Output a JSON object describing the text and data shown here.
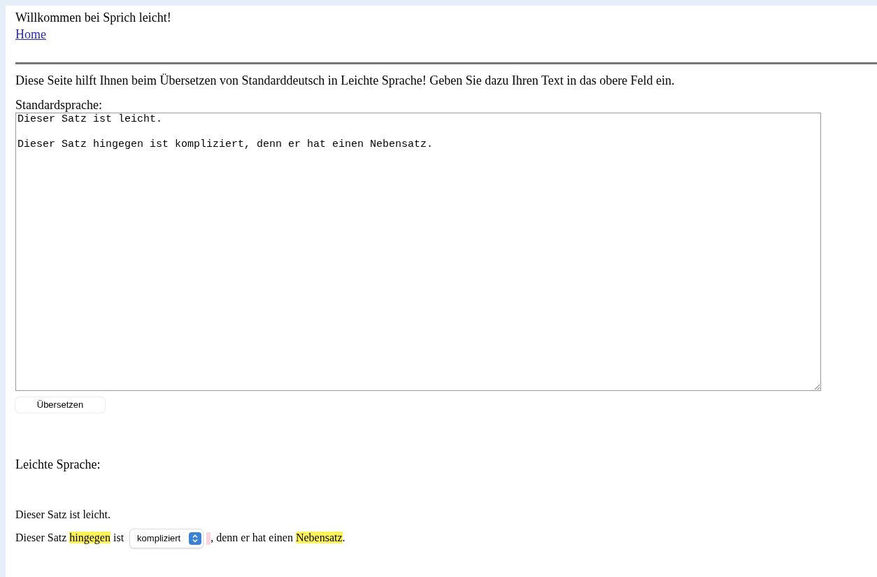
{
  "header": {
    "title": "Willkommen bei Sprich leicht!",
    "home_link": "Home"
  },
  "intro": "Diese Seite hilft Ihnen beim Übersetzen von Standarddeutsch in Leichte Sprache! Geben Sie dazu Ihren Text in das obere Feld ein.",
  "input": {
    "label": "Standardsprache:",
    "value": "Dieser Satz ist leicht.\n\nDieser Satz hingegen ist kompliziert, denn er hat einen Nebensatz."
  },
  "translate_button": "Übersetzen",
  "output": {
    "label": "Leichte Sprache:",
    "sentences": [
      [
        {
          "kind": "text",
          "text": "Dieser Satz ist leicht."
        }
      ],
      [
        {
          "kind": "text",
          "text": "Dieser Satz "
        },
        {
          "kind": "highlight",
          "text": "hingegen",
          "color": "#fff35c"
        },
        {
          "kind": "text",
          "text": " ist "
        },
        {
          "kind": "select",
          "text": "kompliziert"
        },
        {
          "kind": "mark",
          "color": "#fcd5dc"
        },
        {
          "kind": "text",
          "text": ", denn er hat einen "
        },
        {
          "kind": "highlight",
          "text": "Nebensatz",
          "color": "#fff35c"
        },
        {
          "kind": "text",
          "text": "."
        }
      ]
    ]
  }
}
